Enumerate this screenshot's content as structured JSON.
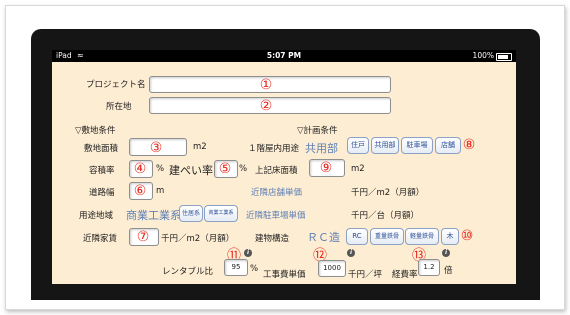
{
  "status": {
    "device": "iPad",
    "time": "5:07 PM",
    "battery": "100%"
  },
  "project": {
    "label": "プロジェクト名",
    "marker": "①"
  },
  "location": {
    "label": "所在地",
    "marker": "②"
  },
  "site_heading": "▽敷地条件",
  "plan_heading": "▽計画条件",
  "site_area": {
    "label": "敷地面積",
    "marker": "③",
    "unit": "m2"
  },
  "floor_ratio": {
    "label": "容積率",
    "marker": "④",
    "unit": "%"
  },
  "coverage": {
    "label": "建ぺい率",
    "marker": "⑤",
    "unit": "%"
  },
  "road_width": {
    "label": "道路幅",
    "marker": "⑥",
    "unit": "m"
  },
  "zoning": {
    "label": "用途地域",
    "value": "商業工業系",
    "buttons": [
      "住居系",
      "商業工業系"
    ]
  },
  "rent": {
    "label": "近隣家賃",
    "marker": "⑦",
    "unit": "千円／m2（月額）"
  },
  "ground_use": {
    "label": "１階屋内用途",
    "value": "共用部",
    "buttons": [
      "住戸",
      "共用部",
      "駐車場",
      "店舗"
    ],
    "marker": "⑧"
  },
  "upper_area": {
    "label": "上記床面積",
    "marker": "⑨",
    "unit": "m2"
  },
  "shop_price": {
    "label": "近隣店舗単価",
    "unit": "千円／m2（月額）"
  },
  "parking_price": {
    "label": "近隣駐車場単価",
    "unit": "千円／台（月額）"
  },
  "structure": {
    "label": "建物構造",
    "value": "ＲＣ造",
    "buttons": [
      "RC",
      "重量鉄骨",
      "軽量鉄骨",
      "木"
    ],
    "marker": "⑩"
  },
  "rentable": {
    "label": "レンタブル比",
    "value": "95",
    "unit": "%",
    "marker": "⑪"
  },
  "construction": {
    "label": "工事費単価",
    "value": "1000",
    "unit": "千円／坪",
    "marker": "⑫"
  },
  "expense": {
    "label": "経費率",
    "value": "1.2",
    "unit": "倍",
    "marker": "⑬"
  },
  "info_icon": "i"
}
